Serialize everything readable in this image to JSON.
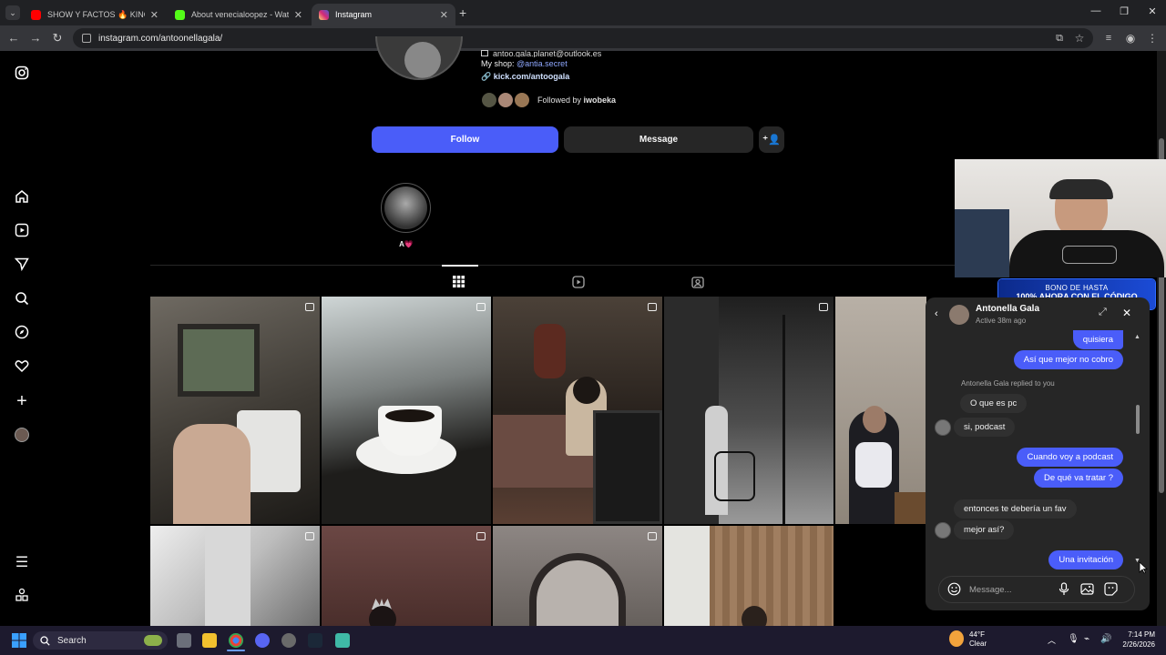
{
  "browser": {
    "tabs": [
      {
        "label": "SHOW Y FACTOS 🔥 KINGTE",
        "active": false,
        "favicon_color": "#ff0000"
      },
      {
        "label": "About venecialoopez - Watch L",
        "active": false,
        "favicon_color": "#53fc18"
      },
      {
        "label": "Instagram",
        "active": true,
        "favicon_color": "#e1306c"
      }
    ],
    "new_tab": "+",
    "url": "instagram.com/antoonellagala/"
  },
  "profile": {
    "email_partial": "antoo.gala.planet@outlook.es",
    "shop_label": "My shop:",
    "shop_handle": "@antia.secret",
    "link": "kick.com/antoogala",
    "followed_by_prefix": "Followed by",
    "followed_by_user": "iwobeka",
    "follow_label": "Follow",
    "message_label": "Message",
    "highlight_label": "A💗"
  },
  "webcam_banner": {
    "line1": "BONO DE HASTA",
    "line2": "100% AHORA CON EL CÓDIGO"
  },
  "chat": {
    "name": "Antonella Gala",
    "status": "Active 38m ago",
    "replied_note": "Antonella Gala replied to you",
    "messages": [
      {
        "from": "me",
        "text": "quisiera"
      },
      {
        "from": "me",
        "text": "Así que mejor no cobro"
      },
      {
        "from": "them",
        "text": "O que es pc"
      },
      {
        "from": "them",
        "text": "si, podcast"
      },
      {
        "from": "me",
        "text": "Cuando voy a podcast"
      },
      {
        "from": "me",
        "text": "De qué va tratar ?"
      },
      {
        "from": "them",
        "text": "entonces te debería un fav"
      },
      {
        "from": "them",
        "text": "mejor así?"
      },
      {
        "from": "me",
        "text": "Una invitación"
      }
    ],
    "input_placeholder": "Message..."
  },
  "taskbar": {
    "search_label": "Search",
    "weather_temp": "44°F",
    "weather_desc": "Clear",
    "time": "7:14 PM",
    "date": "2/26/2026"
  },
  "colors": {
    "accent": "#4a5df9",
    "link": "#e0f1ff",
    "bg": "#000000",
    "panel": "#262626"
  }
}
